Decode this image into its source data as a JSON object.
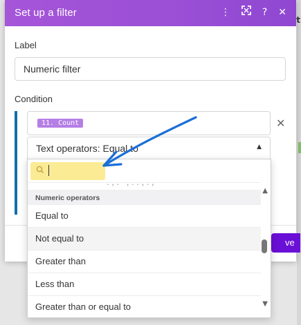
{
  "dialog": {
    "title": "Set up a filter",
    "actions": {
      "kebab_icon": "kebab-vertical-icon",
      "expand_icon": "expand-icon",
      "help_label": "?",
      "close_label": "✕"
    }
  },
  "label_field": {
    "label": "Label",
    "value": "Numeric filter"
  },
  "condition": {
    "label": "Condition",
    "operand_pill": "11. Count",
    "remove_label": "✕",
    "operator_value": "Text operators: Equal to"
  },
  "footer": {
    "save_label": "ve"
  },
  "dropdown": {
    "search_value": "",
    "group_header": "Numeric operators",
    "options": [
      "Equal to",
      "Not equal to",
      "Greater than",
      "Less than",
      "Greater than or equal to"
    ],
    "hovered_index": 1
  },
  "background": {
    "glyph": "t"
  },
  "colors": {
    "header": "#9a4fd5",
    "accent": "#0f6fa8",
    "save": "#6a0fd6",
    "pill": "#b57fe6",
    "annotation_arrow": "#1a6fd6",
    "highlight": "#fbe98a"
  }
}
